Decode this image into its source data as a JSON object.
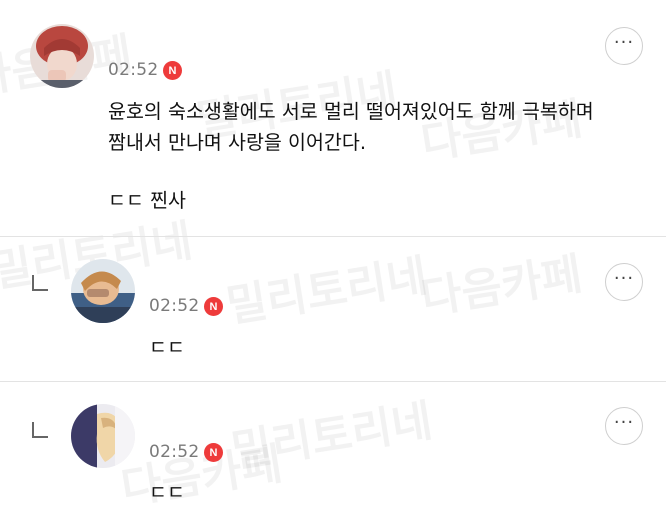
{
  "watermarks": {
    "w1": "다음카페",
    "w2": "밀리토리네",
    "w3": "다음카페",
    "w4": "밀리토리네",
    "w5": "다음카페",
    "w6": "밀리토리네",
    "w7": "다음카페",
    "w8": "밀리토리네"
  },
  "comments": [
    {
      "time": "02:52",
      "badge": "N",
      "more": "···",
      "text_line1": "윤호의 숙소생활에도 서로 멀리 떨어져있어도 함께 극복하며",
      "text_line2": "짬내서 만나며 사랑을 이어간다.",
      "text_line3": "ㄷㄷ 찐사"
    },
    {
      "time": "02:52",
      "badge": "N",
      "more": "···",
      "text": "ㄷㄷ"
    },
    {
      "time": "02:52",
      "badge": "N",
      "more": "···",
      "text": "ㄷㄷ"
    }
  ],
  "colors": {
    "badge": "#ee3b3b",
    "divider": "#e3e3e3",
    "time": "#7a7a7a"
  }
}
